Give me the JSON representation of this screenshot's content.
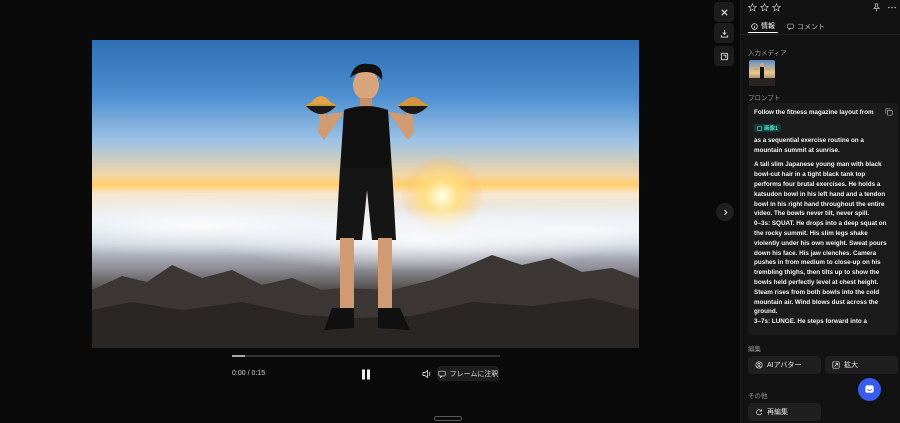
{
  "viewer": {
    "time_display": "0:00 / 0:15",
    "progress": 0.05,
    "frame_note_button": "フレームに注釈",
    "tools": [
      "close-icon",
      "download-icon",
      "expand-icon"
    ],
    "next_icon": "chevron-right-icon"
  },
  "panel": {
    "tabs": [
      {
        "label": "情報",
        "icon": "info-icon",
        "active": true
      },
      {
        "label": "コメント",
        "icon": "comment-icon",
        "active": false
      }
    ],
    "input_media_label": "入力メディア",
    "prompt_label": "プロンプト",
    "prompt": {
      "line1": "Follow the fitness magazine layout from",
      "chip": "画像1",
      "line2": "as a sequential exercise routine on a mountain summit at sunrise.",
      "body": "A tall slim Japanese young man with black bowl-cut hair in a tight black tank top performs four brutal exercises. He holds a katsudon bowl in his left hand and a tendon bowl in his right hand throughout the entire video. The bowls never tilt, never spill.\n0–3s: SQUAT. He drops into a deep squat on the rocky summit. His slim legs shake violently under his own weight. Sweat pours down his face. His jaw clenches. Camera pushes in from medium to close-up on his trembling thighs, then tilts up to show the bowls held perfectly level at chest height. Steam rises from both bowls into the cold mountain air. Wind blows dust across the ground.\n3–7s: LUNGE. He steps forward into a"
    },
    "edit_label": "編集",
    "ai_avatar_button": "AIアバター",
    "upscale_button": "拡大",
    "other_label": "その他",
    "reedit_button": "再編集"
  },
  "colors": {
    "accent": "#3a5bf0",
    "chip_bg": "#153a3a",
    "chip_text": "#59d8c8"
  }
}
